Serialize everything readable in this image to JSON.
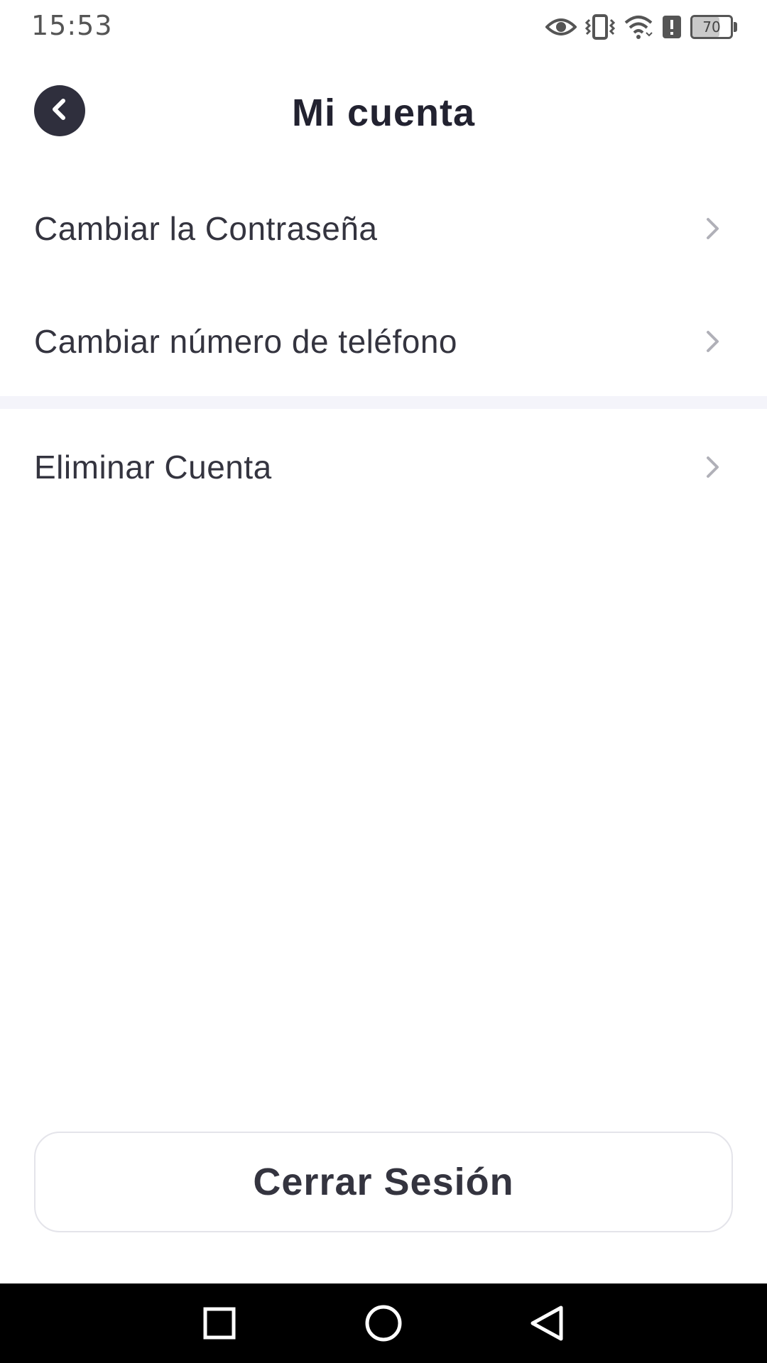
{
  "status_bar": {
    "time": "15:53",
    "battery_level": "70",
    "battery_fraction": 0.7,
    "icons": [
      "eye-icon",
      "vibrate-icon",
      "wifi-icon",
      "alert-icon",
      "battery-icon"
    ]
  },
  "header": {
    "title": "Mi cuenta",
    "back_icon": "chevron-left-icon"
  },
  "menu": {
    "items": [
      {
        "label": "Cambiar la Contraseña",
        "icon": "chevron-right-icon"
      },
      {
        "label": "Cambiar número de teléfono",
        "icon": "chevron-right-icon"
      },
      {
        "label": "Eliminar Cuenta",
        "icon": "chevron-right-icon"
      }
    ]
  },
  "footer": {
    "logout_label": "Cerrar Sesión"
  },
  "nav_bar": {
    "buttons": [
      "recents-square-icon",
      "home-circle-icon",
      "back-triangle-icon"
    ]
  },
  "colors": {
    "text_primary": "#2f2f3d",
    "divider_band": "#f4f4fa",
    "chevron": "#b0b0b8",
    "nav_bar": "#000000"
  }
}
